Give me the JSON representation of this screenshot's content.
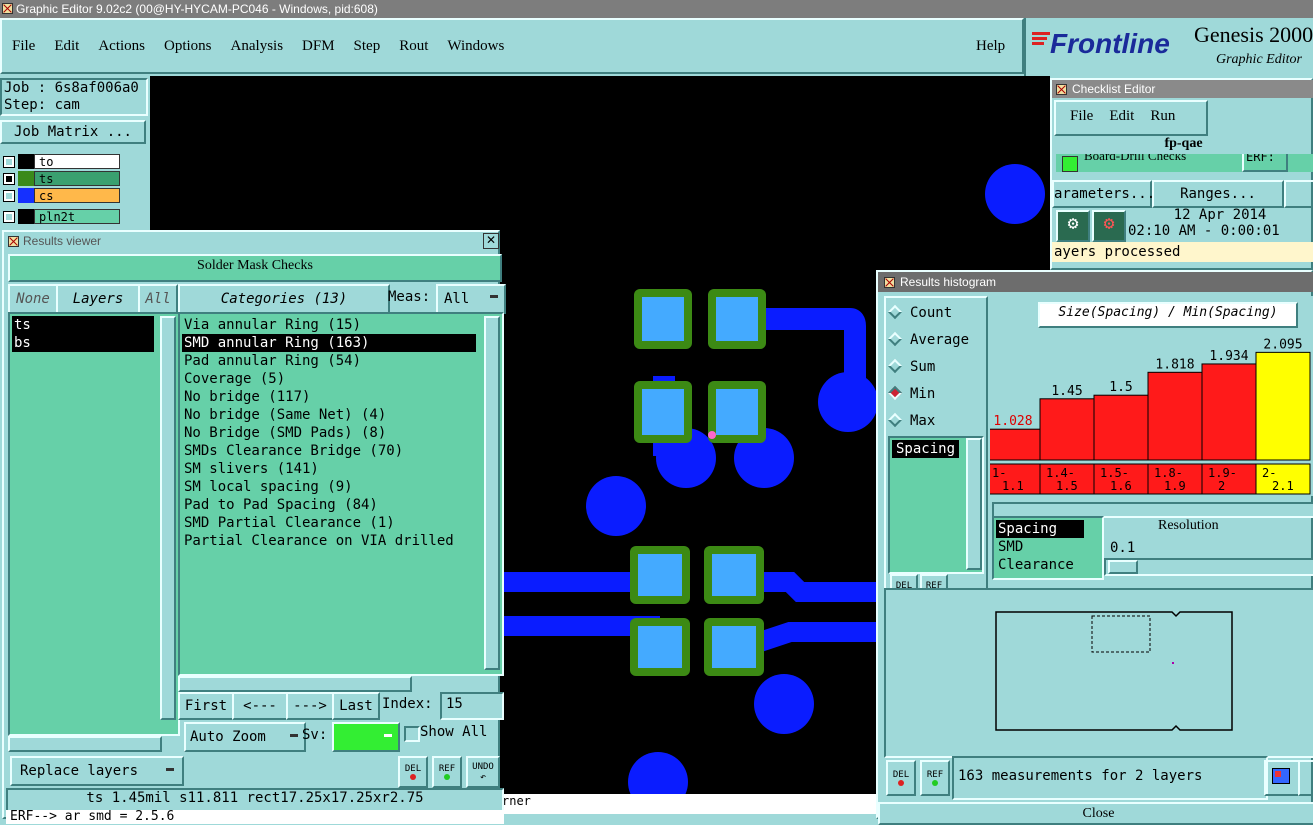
{
  "app_title": "Graphic Editor 9.02c2 (00@HY-HYCAM-PC046 - Windows, pid:608)",
  "menu": [
    "File",
    "Edit",
    "Actions",
    "Options",
    "Analysis",
    "DFM",
    "Step",
    "Rout",
    "Windows"
  ],
  "help": "Help",
  "brand": {
    "logo": "Frontline",
    "product": "Genesis 2000",
    "subtitle": "Graphic Editor"
  },
  "job": {
    "job": "Job : 6s8af006a0",
    "step": "Step: cam",
    "matrix_button": "Job Matrix ..."
  },
  "layers": [
    {
      "name": "to",
      "color": "#000000",
      "row_bg": "#ffffff"
    },
    {
      "name": "ts",
      "color": "#3a8a1a",
      "row_bg": "#3aa070"
    },
    {
      "name": "cs",
      "color": "#1530ff",
      "row_bg": "#ffb84a"
    },
    {
      "name": "pln2t",
      "color": "#000000",
      "row_bg": "#66d0a8"
    }
  ],
  "results_viewer": {
    "title": "Results viewer",
    "header": "Solder Mask Checks",
    "none": "None",
    "layers": "Layers",
    "all": "All",
    "categories": "Categories (13)",
    "meas_label": "Meas:",
    "meas_value": "All",
    "layer_items": [
      "ts",
      "bs"
    ],
    "category_items": [
      "Via annular Ring (15)",
      "SMD annular Ring (163)",
      "Pad annular Ring (54)",
      "Coverage (5)",
      "No bridge (117)",
      "No bridge (Same Net) (4)",
      "No Bridge (SMD Pads) (8)",
      "SMDs Clearance Bridge (70)",
      "SM slivers (141)",
      "SM local spacing (9)",
      "Pad to Pad Spacing (84)",
      "SMD Partial Clearance (1)",
      "Partial Clearance on VIA drilled"
    ],
    "selected_index": 1,
    "first": "First",
    "prev": "<---",
    "next": "--->",
    "last": "Last",
    "index_label": "Index:",
    "index_value": "15",
    "auto_zoom": "Auto Zoom",
    "sv_label": "Sv:",
    "show_all": "Show All",
    "replace_layers": "Replace layers",
    "del": "DEL",
    "ref": "REF",
    "undo": "UNDO",
    "status": "ts 1.45mil  s11.811  rect17.25x17.25xr2.75",
    "erf": "ERF--> ar smd = 2.5.6"
  },
  "canvas_status": "rner",
  "checklist": {
    "title": "Checklist Editor",
    "menu": [
      "File",
      "Edit",
      "Run"
    ],
    "name": "fp-qae",
    "check": "Board-Drill Checks",
    "erf": "ERF:",
    "parameters": "arameters...",
    "ranges": "Ranges...",
    "date": "12 Apr 2014",
    "time": "02:10 AM - 0:00:01",
    "processed": "ayers processed"
  },
  "histogram": {
    "title": "Results histogram",
    "modes": [
      "Count",
      "Average",
      "Sum",
      "Min",
      "Max"
    ],
    "mode_selected": 3,
    "chart_title": "Size(Spacing) / Min(Spacing)",
    "list_selected": "Spacing",
    "bars": [
      {
        "label": "1.028",
        "range": [
          "1-",
          "1.1"
        ],
        "value": 1.028,
        "color": "#ff1a1a"
      },
      {
        "label": "1.45",
        "range": [
          "1.4-",
          "1.5"
        ],
        "value": 1.45,
        "color": "#ff1a1a"
      },
      {
        "label": "1.5",
        "range": [
          "1.5-",
          "1.6"
        ],
        "value": 1.5,
        "color": "#ff1a1a"
      },
      {
        "label": "1.818",
        "range": [
          "1.8-",
          "1.9"
        ],
        "value": 1.818,
        "color": "#ff1a1a"
      },
      {
        "label": "1.934",
        "range": [
          "1.9-",
          "2"
        ],
        "value": 1.934,
        "color": "#ff1a1a"
      },
      {
        "label": "2.095",
        "range": [
          "2-",
          "2.1"
        ],
        "value": 2.095,
        "color": "#ffff00"
      }
    ],
    "types": [
      "Spacing",
      "SMD",
      "Clearance"
    ],
    "resolution_label": "Resolution",
    "resolution_value": "0.1",
    "del": "DEL",
    "ref": "REF",
    "measurements": "163 measurements for 2 layers",
    "close": "Close"
  }
}
